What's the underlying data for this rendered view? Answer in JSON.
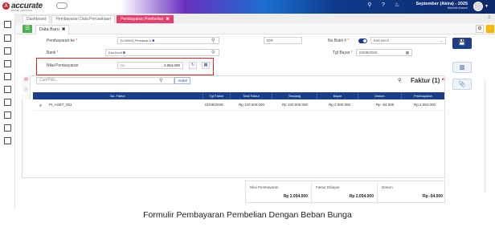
{
  "app": {
    "logo_text": "accurate",
    "logo_sub": "ONLINE LEARNING",
    "user_name": "September (Akira) - 2025",
    "user_sub": "Michelle Arisanti"
  },
  "module_tabs": [
    {
      "label": "Dashboard"
    },
    {
      "label": "Pembayaran Data Perusahaan"
    },
    {
      "label": "Pembayaran Pembelian",
      "close": "✖"
    }
  ],
  "module_count": "3",
  "subtab": {
    "label": "Data Baru",
    "close": "✖"
  },
  "form": {
    "pemasok_label": "Pembayaran ke",
    "pemasok_value": "[V.00001] Pemasok A",
    "currency": "IDR",
    "bank_label": "Bank",
    "bank_value": "Kas Kecil",
    "nilai_label": "Nilai Pembayaran",
    "nilai_prefix": "Rp",
    "nilai_value": "2.054.000",
    "nobukti_label": "No Bukti #",
    "nobukti_value": "Kas Kecil",
    "tglbayar_label": "Tgl Bayar",
    "tglbayar_value": "04/09/2025"
  },
  "detail": {
    "search_placeholder": "Cari/Pilih...",
    "ambil_label": "Ambil",
    "faktur_title": "Faktur (1)",
    "columns": [
      "No. Faktur",
      "Tgl Faktur",
      "Total Faktur",
      "Terutang",
      "Bayar",
      "Diskon",
      "Pembayaran"
    ],
    "rows": [
      {
        "no": "PI_ASET_001",
        "tgl": "01/09/2025",
        "total": "Rp 120.000.000",
        "terutang": "Rp 100.000.000",
        "bayar": "Rp 2.000.000",
        "diskon": "Rp -54.000",
        "pembayaran": "Rp 2.054.000"
      }
    ]
  },
  "summary": {
    "nilai_label": "Nilai Pembayaran",
    "nilai_value": "Rp 2.054.000",
    "faktur_label": "Faktur Dibayar",
    "faktur_value": "Rp 2.054.000",
    "diskon_label": "Diskon",
    "diskon_value": "Rp -54.000"
  },
  "caption": "Formulir Pembayaran Pembelian Dengan Beban Bunga",
  "colors": {
    "accent": "#1a3e8a",
    "tab_active": "#e43f6f",
    "highlight": "#e02020"
  }
}
